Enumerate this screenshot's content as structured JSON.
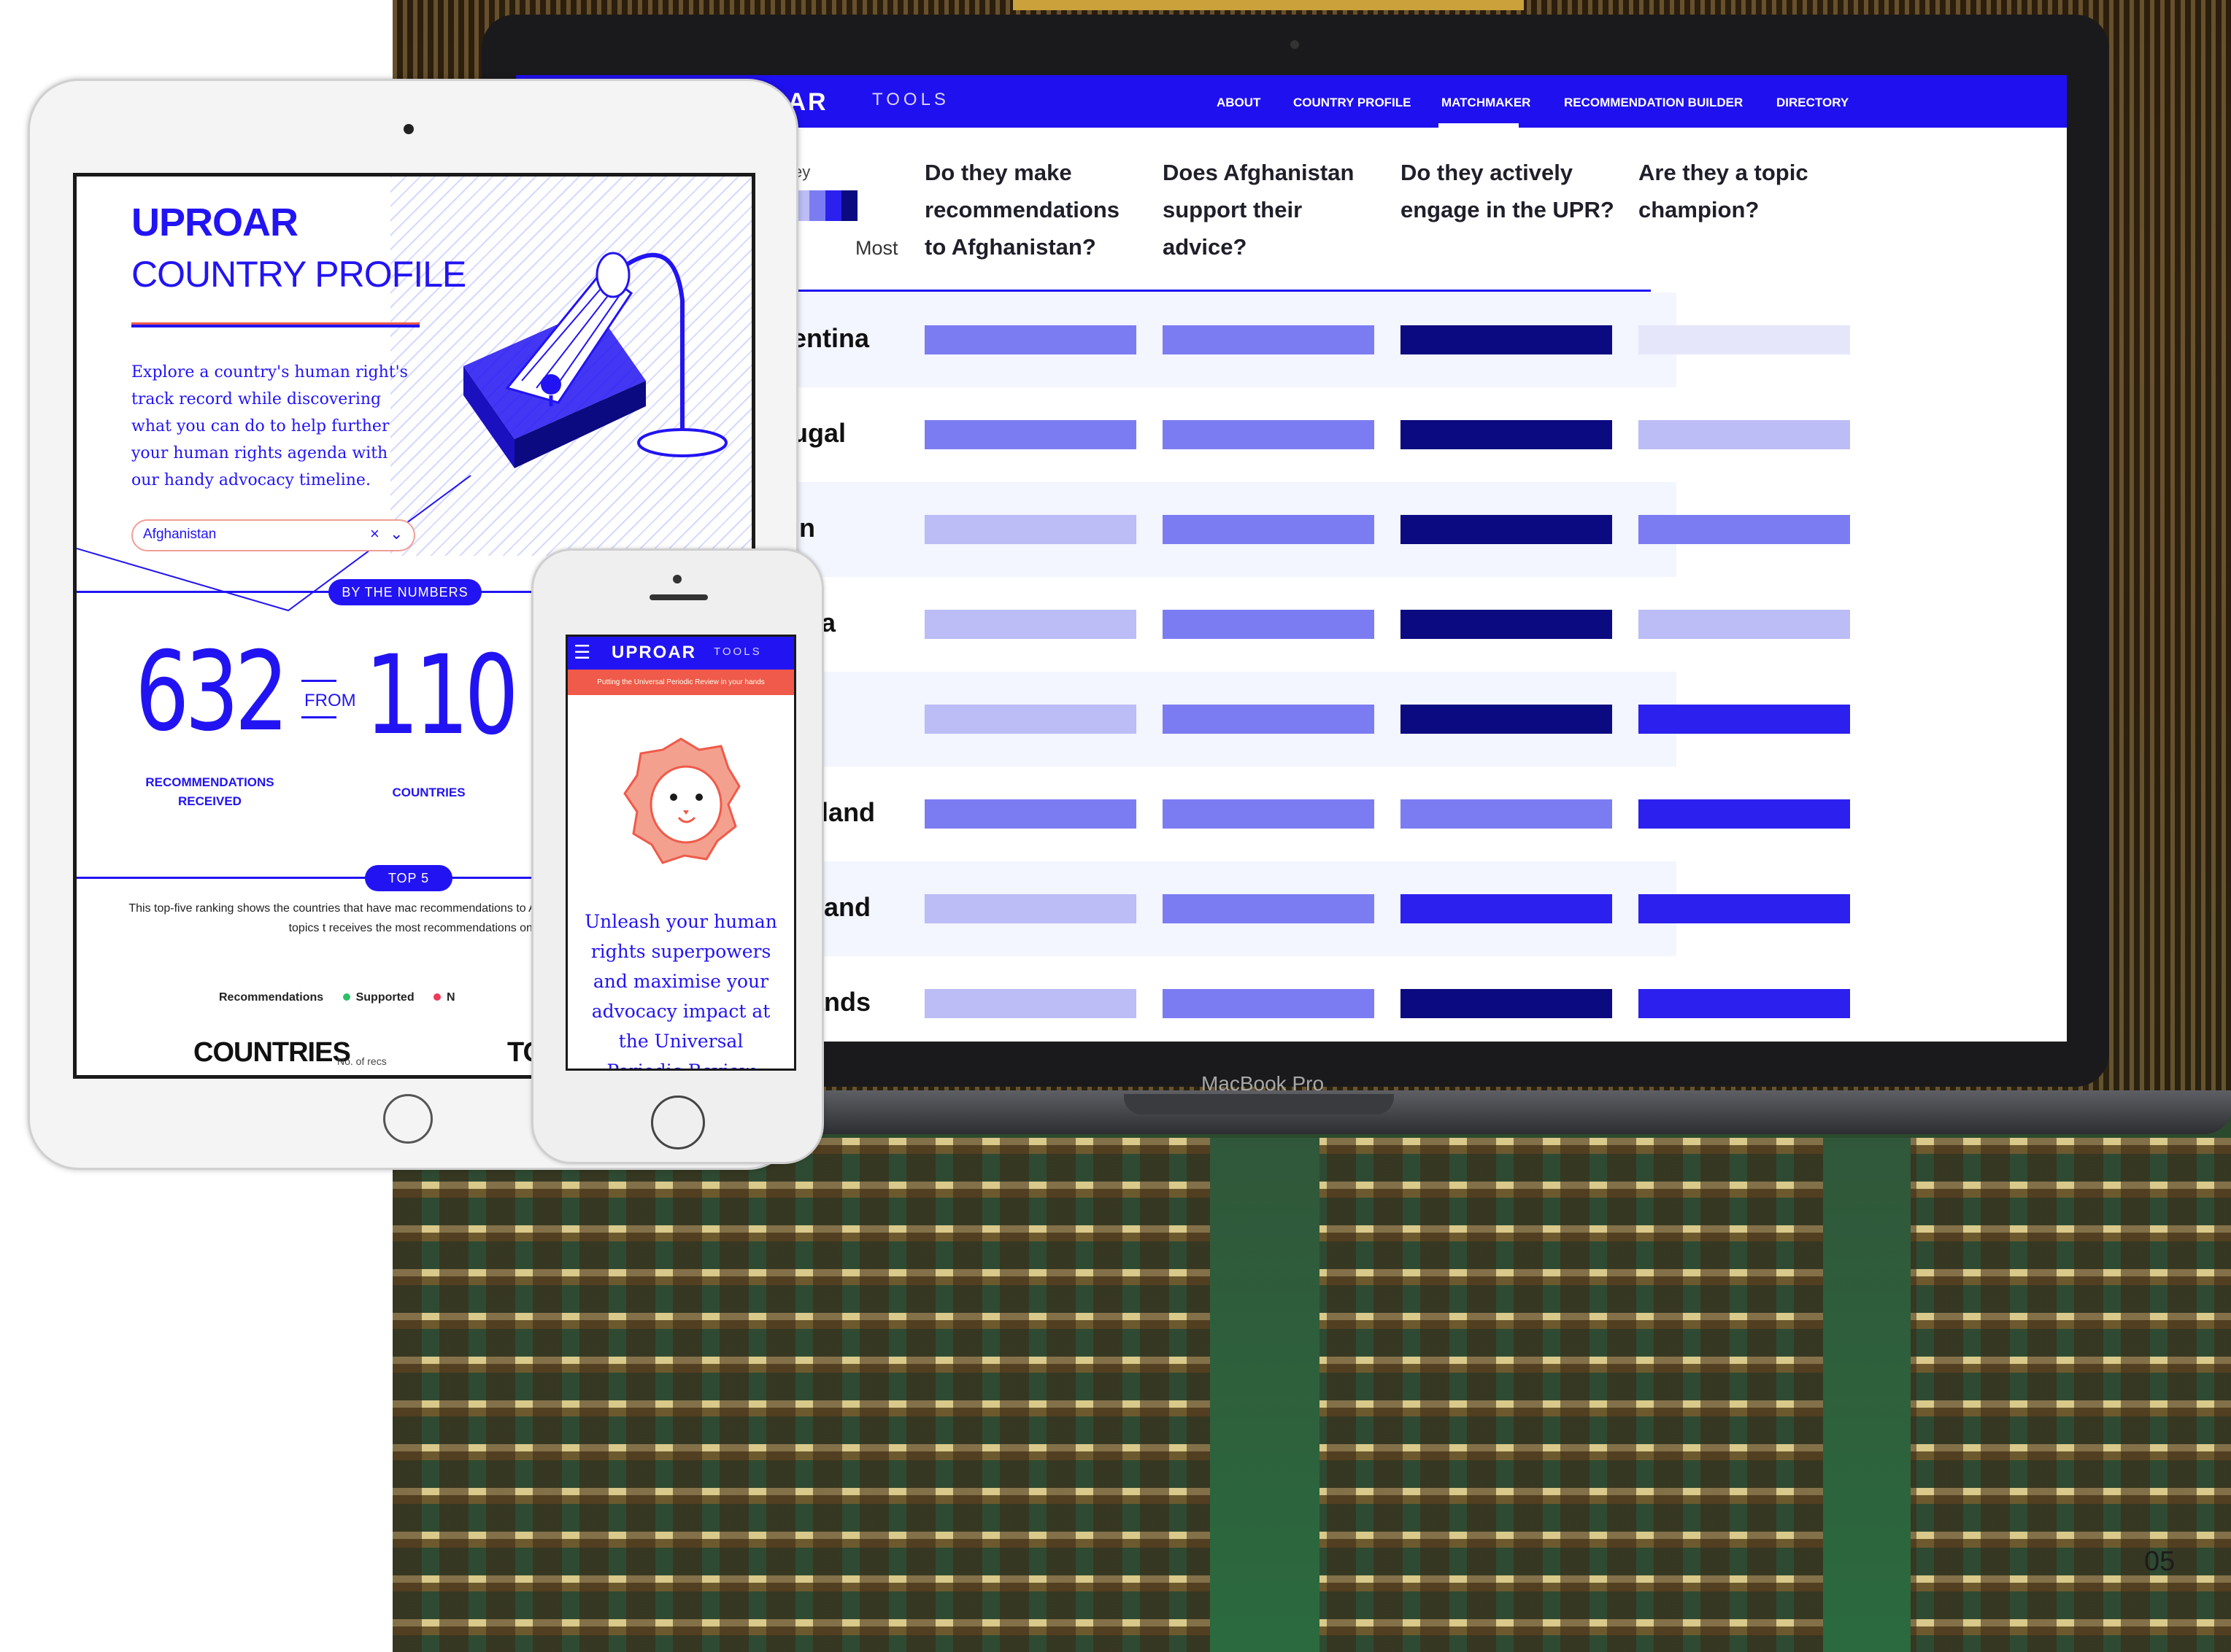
{
  "page_number": "05",
  "laptop": {
    "brand_label": "MacBook Pro",
    "nav": {
      "logo": "OAR",
      "tools": "TOOLS",
      "links": [
        "ABOUT",
        "COUNTRY PROFILE",
        "MATCHMAKER",
        "RECOMMENDATION BUILDER",
        "DIRECTORY"
      ],
      "active": "MATCHMAKER"
    },
    "legend": {
      "label": "ey",
      "most": "Most"
    },
    "questions": [
      "Do they make recommendations to Afghanistan?",
      "Does Afghanistan support their advice?",
      "Do they actively engage in the UPR?",
      "Are they a topic champion?"
    ],
    "rows": [
      {
        "country": "entina",
        "levels": [
          3,
          3,
          5,
          1
        ]
      },
      {
        "country": "ugal",
        "levels": [
          3,
          3,
          5,
          2
        ]
      },
      {
        "country": "in",
        "levels": [
          2,
          3,
          5,
          3
        ]
      },
      {
        "country": "alia",
        "levels": [
          2,
          3,
          5,
          2
        ]
      },
      {
        "country": "en",
        "levels": [
          2,
          3,
          5,
          4
        ]
      },
      {
        "country": "ealand",
        "levels": [
          3,
          3,
          3,
          4
        ]
      },
      {
        "country": "erland",
        "levels": [
          2,
          3,
          4,
          4
        ]
      },
      {
        "country": "rlands",
        "levels": [
          2,
          3,
          5,
          4
        ]
      }
    ],
    "level_colors": [
      "#ffffff",
      "#e6e6fb",
      "#bcbcf6",
      "#7c7cf2",
      "#2b20ee",
      "#0b0a80"
    ]
  },
  "tablet": {
    "brand": "UPROAR",
    "title": "COUNTRY PROFILE",
    "description": "Explore a country's human right's track record while discovering what you can do to help further your human rights agenda with our handy advocacy timeline.",
    "select_value": "Afghanistan",
    "select_clear": "×",
    "select_chevron": "⌄",
    "by_numbers_label": "BY THE NUMBERS",
    "recs_number": "632",
    "recs_label_1": "RECOMMENDATIONS",
    "recs_label_2": "RECEIVED",
    "from_label": "FROM",
    "countries_number": "110",
    "countries_label": "COUNTRIES",
    "top5_label": "TOP 5",
    "top5_text": "This top-five ranking shows the countries that have mac recommendations to Afghanistan at the UPR, and the topics t receives the most recommendations on.",
    "legend": {
      "recommendations": "Recommendations",
      "supported": "Supported",
      "noted": "N"
    },
    "countries_heading": "COUNTRIES",
    "no_of_recs": "No. of recs",
    "topics_heading": "TOPIC"
  },
  "phone": {
    "logo": "UPROAR",
    "tools": "TOOLS",
    "banner": "Putting the Universal Periodic Review in your hands",
    "text": "Unleash your human rights superpowers and maximise your advocacy impact at the Universal Periodic Review using our"
  },
  "colors": {
    "accent": "#2214f2",
    "coral": "#ef5a4a",
    "dark_navy": "#0b0a80"
  }
}
